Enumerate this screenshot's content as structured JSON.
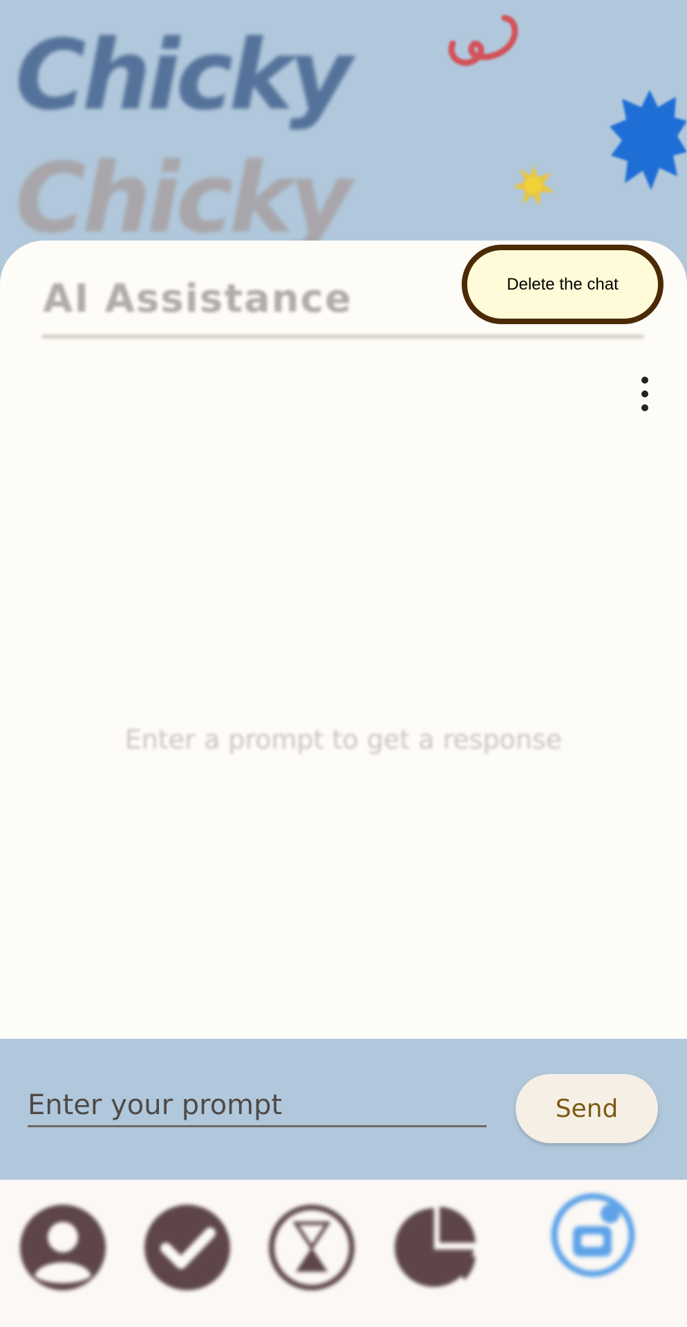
{
  "app": {
    "logo_text": "Chicky",
    "logo_shadow_text": "Chicky"
  },
  "chat_card": {
    "title": "AI Assistance",
    "empty_hint": "Enter a prompt to get a response",
    "menu_icon": "more-vert-icon"
  },
  "tooltip": {
    "text": "Delete the chat"
  },
  "composer": {
    "placeholder": "Enter your prompt",
    "value": "",
    "send_label": "Send"
  },
  "bottom_nav": {
    "items": [
      {
        "icon": "profile-icon",
        "active": false
      },
      {
        "icon": "check-icon",
        "active": false
      },
      {
        "icon": "hourglass-icon",
        "active": false
      },
      {
        "icon": "pie-chart-icon",
        "active": false
      },
      {
        "icon": "assistant-bot-icon",
        "active": true
      }
    ]
  },
  "colors": {
    "header_bg": "#b1c8dc",
    "card_bg": "#fefcf7",
    "tooltip_border": "#4b2a06",
    "tooltip_bg": "#fffbd8",
    "nav_icon": "#5e4648",
    "nav_active": "#5ea2e8",
    "send_text": "#7a5b10"
  }
}
